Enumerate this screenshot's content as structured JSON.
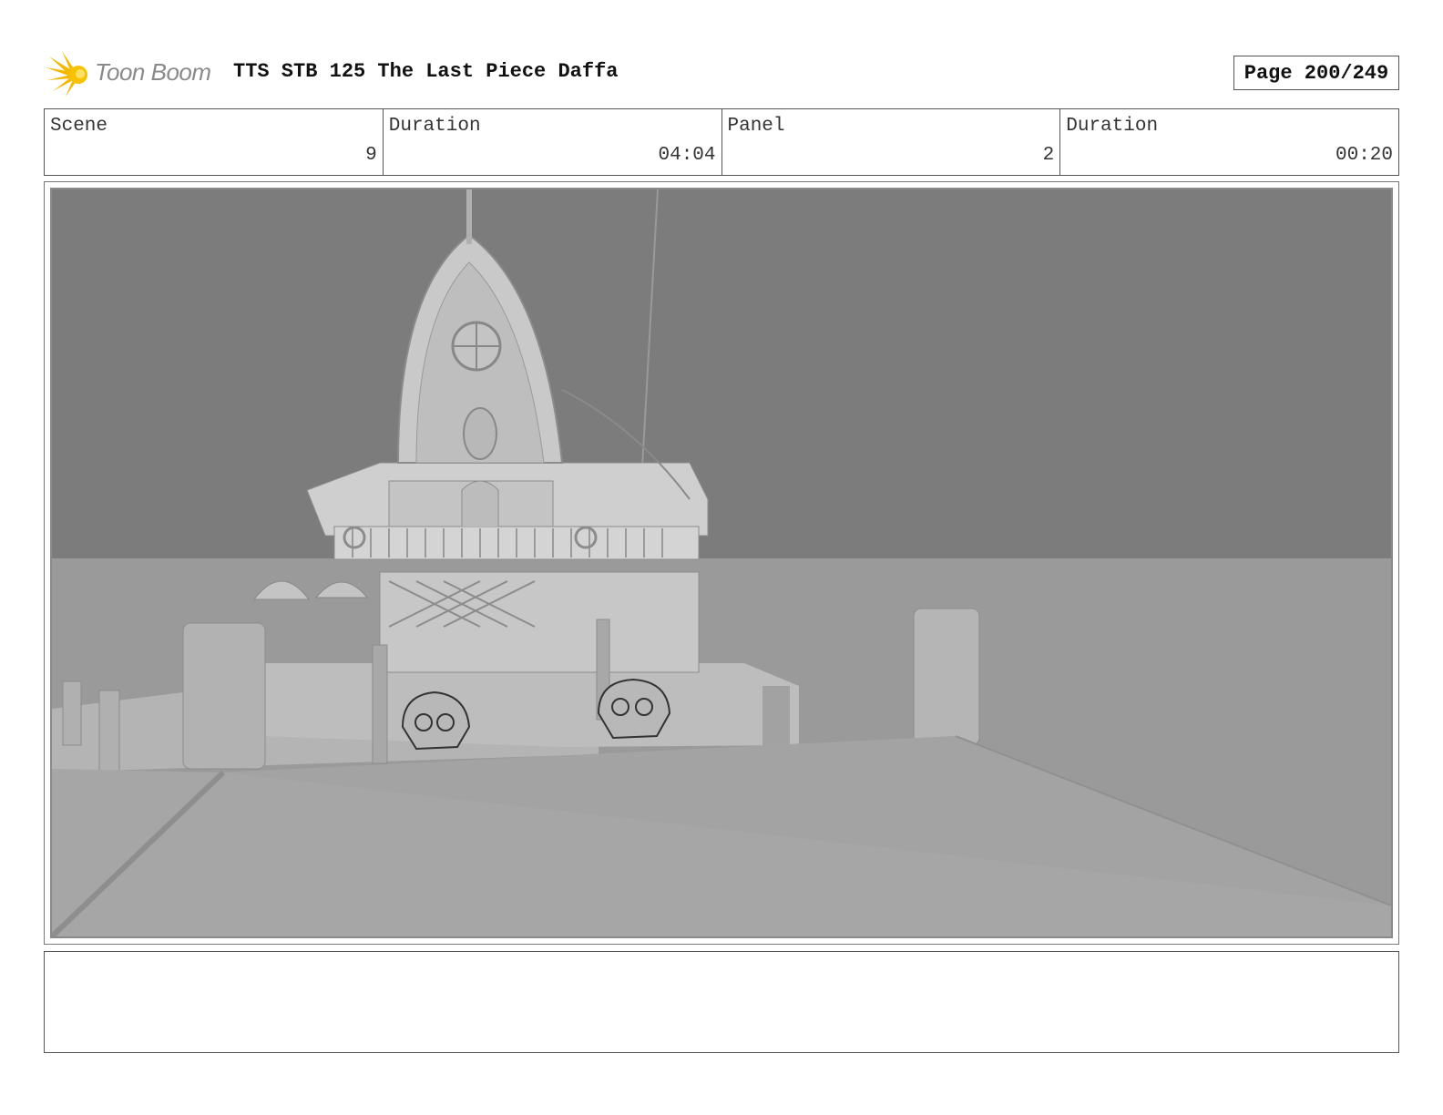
{
  "header": {
    "logo_text": "Toon Boom",
    "title": "TTS STB 125 The Last Piece Daffa",
    "page_indicator": "Page 200/249"
  },
  "info": {
    "scene_label": "Scene",
    "scene_value": "9",
    "scene_duration_label": "Duration",
    "scene_duration_value": "04:04",
    "panel_label": "Panel",
    "panel_value": "2",
    "panel_duration_label": "Duration",
    "panel_duration_value": "00:20"
  },
  "colors": {
    "sky": "#7c7c7c",
    "sea": "#9a9a9a",
    "foreground_dock": "#a6a6a6",
    "building": "#c9c9c9",
    "logo_yellow": "#f5b800"
  },
  "notes": {
    "text": ""
  }
}
